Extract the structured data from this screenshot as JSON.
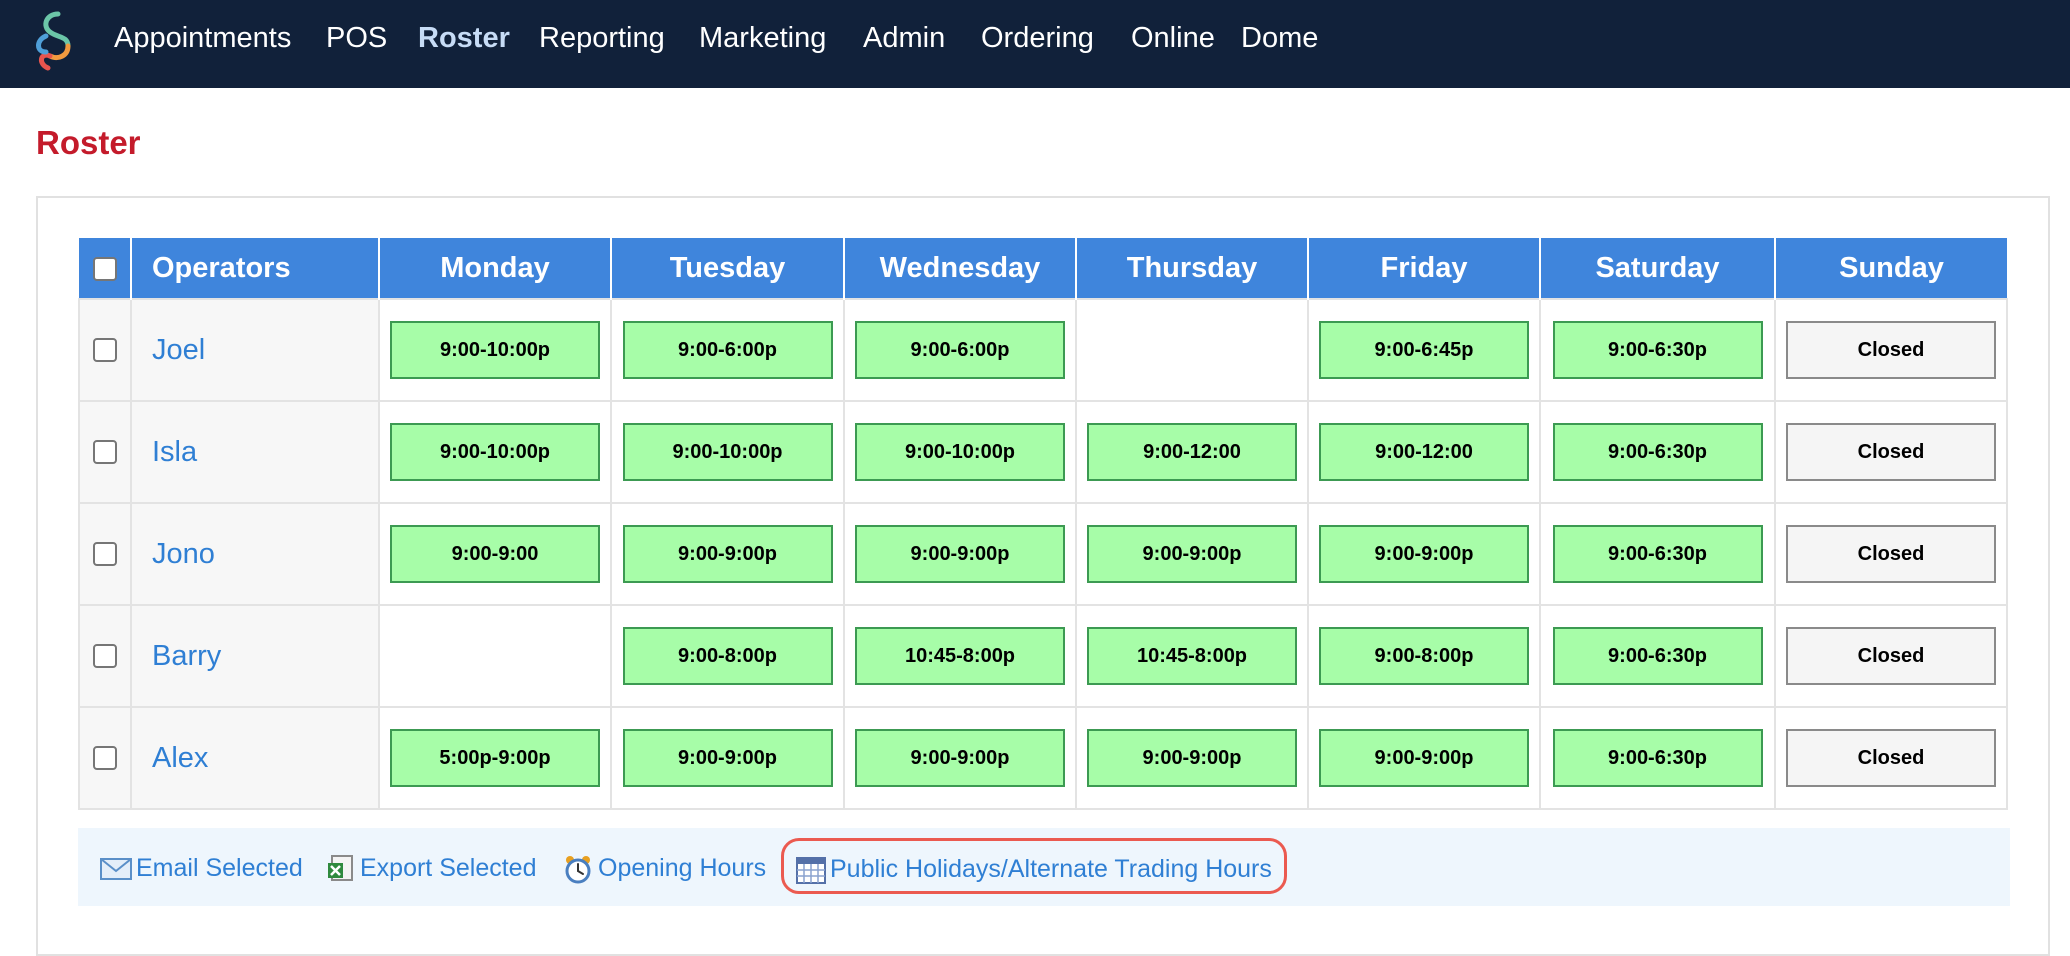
{
  "nav": {
    "items": [
      {
        "label": "Appointments",
        "active": false
      },
      {
        "label": "POS",
        "active": false
      },
      {
        "label": "Roster",
        "active": true
      },
      {
        "label": "Reporting",
        "active": false
      },
      {
        "label": "Marketing",
        "active": false
      },
      {
        "label": "Admin",
        "active": false
      },
      {
        "label": "Ordering",
        "active": false
      },
      {
        "label": "Online",
        "active": false
      },
      {
        "label": "Dome",
        "active": false
      }
    ]
  },
  "page": {
    "title": "Roster"
  },
  "table": {
    "operators_header": "Operators",
    "days": [
      "Monday",
      "Tuesday",
      "Wednesday",
      "Thursday",
      "Friday",
      "Saturday",
      "Sunday"
    ],
    "rows": [
      {
        "name": "Joel",
        "shifts": [
          "9:00-10:00p",
          "9:00-6:00p",
          "9:00-6:00p",
          "",
          "9:00-6:45p",
          "9:00-6:30p",
          "Closed"
        ]
      },
      {
        "name": "Isla",
        "shifts": [
          "9:00-10:00p",
          "9:00-10:00p",
          "9:00-10:00p",
          "9:00-12:00",
          "9:00-12:00",
          "9:00-6:30p",
          "Closed"
        ]
      },
      {
        "name": "Jono",
        "shifts": [
          "9:00-9:00",
          "9:00-9:00p",
          "9:00-9:00p",
          "9:00-9:00p",
          "9:00-9:00p",
          "9:00-6:30p",
          "Closed"
        ]
      },
      {
        "name": "Barry",
        "shifts": [
          "",
          "9:00-8:00p",
          "10:45-8:00p",
          "10:45-8:00p",
          "9:00-8:00p",
          "9:00-6:30p",
          "Closed"
        ]
      },
      {
        "name": "Alex",
        "shifts": [
          "5:00p-9:00p",
          "9:00-9:00p",
          "9:00-9:00p",
          "9:00-9:00p",
          "9:00-9:00p",
          "9:00-6:30p",
          "Closed"
        ]
      }
    ]
  },
  "actions": {
    "email_selected": "Email Selected",
    "export_selected": "Export Selected",
    "opening_hours": "Opening Hours",
    "public_holidays": "Public Holidays/Alternate Trading Hours"
  },
  "icons": {
    "logo": "swirl-logo-icon",
    "email": "envelope-icon",
    "export": "spreadsheet-export-icon",
    "opening_hours": "alarm-clock-icon",
    "public_holidays": "calendar-icon"
  },
  "colors": {
    "nav_bg": "#11213a",
    "title": "#c41b2b",
    "table_header": "#3f85dc",
    "link": "#2f7fd4",
    "shift_bg": "#a7fda8",
    "shift_border": "#3c9a52",
    "closed_bg": "#f5f5f5",
    "highlight": "#eb5a50"
  }
}
